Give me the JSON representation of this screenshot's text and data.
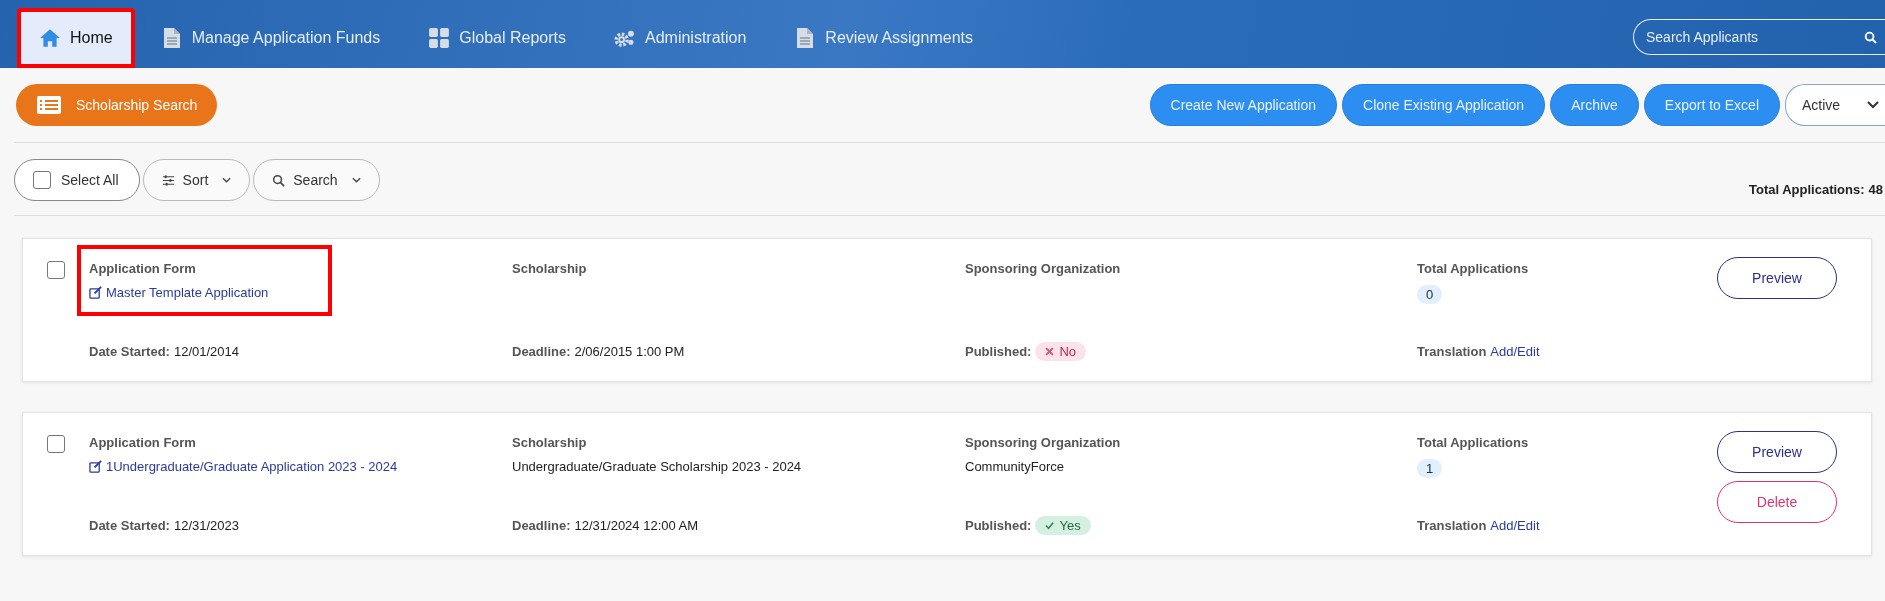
{
  "nav": {
    "items": [
      {
        "label": "Home",
        "kind": "home",
        "selected": true,
        "highlighted": true
      },
      {
        "label": "Manage Application Funds",
        "kind": "document",
        "selected": false,
        "highlighted": false
      },
      {
        "label": "Global Reports",
        "kind": "grid",
        "selected": false,
        "highlighted": false
      },
      {
        "label": "Administration",
        "kind": "gears",
        "selected": false,
        "highlighted": false
      },
      {
        "label": "Review Assignments",
        "kind": "document",
        "selected": false,
        "highlighted": false
      }
    ],
    "search": {
      "placeholder": "Search Applicants"
    }
  },
  "toolbar": {
    "scholarship_search": "Scholarship Search",
    "actions": [
      "Create New Application",
      "Clone Existing Application",
      "Archive",
      "Export to Excel"
    ],
    "status_select": "Active"
  },
  "filters": {
    "select_all": {
      "label": "Select All",
      "checked": false
    },
    "sort": "Sort",
    "search": "Search",
    "total": {
      "label": "Total Applications:",
      "value": "48"
    }
  },
  "applications": [
    {
      "checked": false,
      "form_label": "Application Form",
      "form_name": "Master Template Application",
      "highlighted": true,
      "scholarship_label": "Scholarship",
      "sponsor_label": "Sponsoring Organization",
      "total_label": "Total Applications",
      "total": "0",
      "date_label": "Date Started:",
      "date": "12/01/2014",
      "deadline_label": "Deadline:",
      "deadline": "2/06/2015 1:00 PM",
      "published_label": "Published:",
      "published": {
        "value": "No",
        "on": false
      },
      "translation_label": "Translation",
      "translation_link": "Add/Edit",
      "buttons": [
        {
          "label": "Preview",
          "kind": "preview"
        }
      ]
    },
    {
      "checked": false,
      "form_label": "Application Form",
      "form_name": "1Undergraduate/Graduate Application 2023 - 2024",
      "highlighted": false,
      "scholarship_label": "Scholarship",
      "scholarship": "Undergraduate/Graduate Scholarship 2023 - 2024",
      "sponsor_label": "Sponsoring Organization",
      "sponsor": "CommunityForce",
      "total_label": "Total Applications",
      "total": "1",
      "date_label": "Date Started:",
      "date": "12/31/2023",
      "deadline_label": "Deadline:",
      "deadline": "12/31/2024 12:00 AM",
      "published_label": "Published:",
      "published": {
        "value": "Yes",
        "on": true
      },
      "translation_label": "Translation",
      "translation_link": "Add/Edit",
      "buttons": [
        {
          "label": "Preview",
          "kind": "preview"
        },
        {
          "label": "Delete",
          "kind": "delete"
        }
      ]
    }
  ]
}
